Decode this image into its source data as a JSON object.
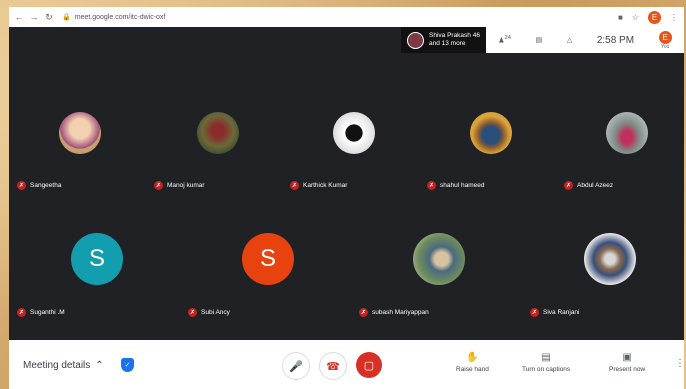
{
  "browser": {
    "url": "meet.google.com/itc-dwic-oxf",
    "profile_initial": "E"
  },
  "topbar": {
    "presenter_line1": "Shiva Prakash 46",
    "presenter_line2": "and 13 more",
    "people_count": "24",
    "time": "2:58 PM",
    "self_initial": "E",
    "self_label": "You"
  },
  "participants": [
    {
      "name": "Sangeetha",
      "type": "photo",
      "color": "#c8a070"
    },
    {
      "name": "Manoj kumar",
      "type": "photo",
      "color": "#7a5a3a"
    },
    {
      "name": "Karthick Kumar",
      "type": "photo",
      "color": "#e8e8e8"
    },
    {
      "name": "shahul hameed",
      "type": "photo",
      "color": "#d9a23a"
    },
    {
      "name": "Abdul Azeez",
      "type": "photo",
      "color": "#9aa6a0"
    },
    {
      "name": "Suganthi .M",
      "type": "letter",
      "letter": "S",
      "color": "#129eaf"
    },
    {
      "name": "Subi Ancy",
      "type": "letter",
      "letter": "S",
      "color": "#e8430f"
    },
    {
      "name": "subash Mariyappan",
      "type": "photo",
      "color": "#6f8d5c"
    },
    {
      "name": "Siva Ranjani",
      "type": "photo",
      "color": "#3a4f7a"
    }
  ],
  "bottombar": {
    "meeting_details": "Meeting details",
    "raise_hand": "Raise hand",
    "captions": "Turn on captions",
    "present": "Present now"
  }
}
